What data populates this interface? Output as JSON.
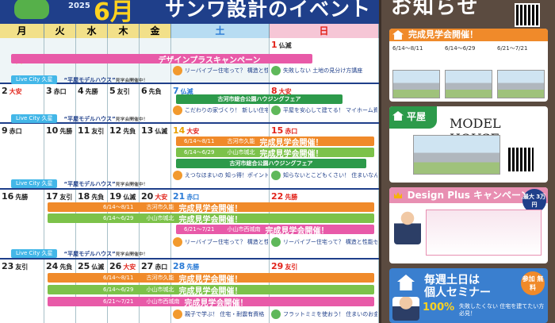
{
  "header": {
    "year": "2025",
    "month": "6月",
    "title": "サンワ設計のイベント"
  },
  "days_of_week": [
    "月",
    "火",
    "水",
    "木",
    "金",
    "土",
    "日"
  ],
  "weeks": [
    {
      "days": [
        {
          "num": "",
          "tag": ""
        },
        {
          "num": "",
          "tag": ""
        },
        {
          "num": "",
          "tag": ""
        },
        {
          "num": "",
          "tag": ""
        },
        {
          "num": "",
          "tag": ""
        },
        {
          "num": "",
          "tag": ""
        },
        {
          "num": "1",
          "tag": "仏滅"
        }
      ],
      "campaign": "デザインプラスキャンペーン",
      "events": [
        "リーバイブー住宅って？ 構造と性能セミナー",
        "失敗しない 土地の見分け方講座"
      ],
      "live_city": "Live City 久星",
      "model_house": "“平屋モデルハウス”",
      "model_note": "見学会開催中！"
    },
    {
      "days": [
        {
          "num": "2",
          "tag": "大安"
        },
        {
          "num": "3",
          "tag": "赤口"
        },
        {
          "num": "4",
          "tag": "先勝"
        },
        {
          "num": "5",
          "tag": "友引"
        },
        {
          "num": "6",
          "tag": "先負"
        },
        {
          "num": "7",
          "tag": "仏滅"
        },
        {
          "num": "8",
          "tag": "大安"
        }
      ],
      "fair": "古河市総合公園ハウジングフェア",
      "events": [
        "こだわりの家づくり！ 新しい住宅の流れセミナー",
        "平屋を安心して建てる！ マイホーム資金講座"
      ],
      "live_city": "Live City 久星",
      "model_house": "“平屋モデルハウス”",
      "model_note": "見学会開催中！"
    },
    {
      "days": [
        {
          "num": "9",
          "tag": "赤口"
        },
        {
          "num": "10",
          "tag": "先勝"
        },
        {
          "num": "11",
          "tag": "友引"
        },
        {
          "num": "12",
          "tag": "先負"
        },
        {
          "num": "13",
          "tag": "仏滅"
        },
        {
          "num": "14",
          "tag": "大安"
        },
        {
          "num": "15",
          "tag": "赤口"
        }
      ],
      "kansei": [
        {
          "date": "6/14～8/11",
          "place": "古河市久能",
          "label": "完成見学会開催！"
        },
        {
          "date": "6/14～6/29",
          "place": "小山市城北",
          "label": "完成見学会開催！"
        }
      ],
      "fair": "古河市総合公園ハウジングフェア",
      "events": [
        "えつなほまいの 知っ得！ポイント解説会",
        "知らないとこどもくさい！ 住まいなんでも相談会"
      ],
      "live_city": "Live City 久星",
      "model_house": "“平屋モデルハウス”",
      "model_note": "見学会開催中！"
    },
    {
      "days": [
        {
          "num": "16",
          "tag": "先勝"
        },
        {
          "num": "17",
          "tag": "友引"
        },
        {
          "num": "18",
          "tag": "先負"
        },
        {
          "num": "19",
          "tag": "仏滅"
        },
        {
          "num": "20",
          "tag": "大安"
        },
        {
          "num": "21",
          "tag": "赤口"
        },
        {
          "num": "22",
          "tag": "先勝"
        }
      ],
      "kansei": [
        {
          "date": "6/14～8/11",
          "place": "古河市久能",
          "label": "完成見学会開催！"
        },
        {
          "date": "6/14～6/29",
          "place": "小山市城北",
          "label": "完成見学会開催！"
        },
        {
          "date": "6/21～7/21",
          "place": "小山市西城南",
          "label": "完成見学会開催！"
        }
      ],
      "events": [
        "リーバイブー住宅って？ 構造と性能セミナー",
        "リーバイブー住宅って？ 構造と性能セミナー"
      ],
      "live_city": "Live City 久星",
      "model_house": "“平屋モデルハウス”",
      "model_note": "見学会開催中！"
    },
    {
      "days": [
        {
          "num": "23",
          "tag": "友引"
        },
        {
          "num": "24",
          "tag": "先負"
        },
        {
          "num": "25",
          "tag": "仏滅"
        },
        {
          "num": "26",
          "tag": "大安"
        },
        {
          "num": "27",
          "tag": "赤口"
        },
        {
          "num": "28",
          "tag": "先勝"
        },
        {
          "num": "29",
          "tag": "友引"
        }
      ],
      "kansei": [
        {
          "date": "6/14～8/11",
          "place": "古河市久能",
          "label": "完成見学会開催！"
        },
        {
          "date": "6/14～6/29",
          "place": "小山市城北",
          "label": "完成見学会開催！"
        },
        {
          "date": "6/21～7/21",
          "place": "小山市西城南",
          "label": "完成見学会開催！"
        }
      ],
      "events": [
        "親子で学ぶ！ 住宅・耐震有資格",
        "フラットミミを使おう！ 住まいのお金セミナー"
      ]
    }
  ],
  "right_panel": {
    "title": "お知らせ",
    "kansei_header": "完成見学会開催！",
    "periods": [
      "6/14～8/11",
      "6/14～6/29",
      "6/21～7/21"
    ],
    "model_header": "平屋",
    "model_title": "MODEL HOUSE",
    "design_header": "Design Plus キャンペーン",
    "design_badge": "最大 3万円",
    "seminar_line1": "毎週土日は",
    "seminar_line2": "個人セミナー",
    "seminar_badge": "参加 無料",
    "seminar_pct": "100%",
    "seminar_copy": "失敗したくない 住宅を建てたい方必見！"
  },
  "colors": {
    "navy": "#1f3f8a",
    "orange": "#f08a2a",
    "green": "#2c9a4a",
    "pink": "#e85aa8",
    "cyan": "#43b7e8",
    "red": "#e2231a",
    "blue": "#2a7bd6"
  }
}
